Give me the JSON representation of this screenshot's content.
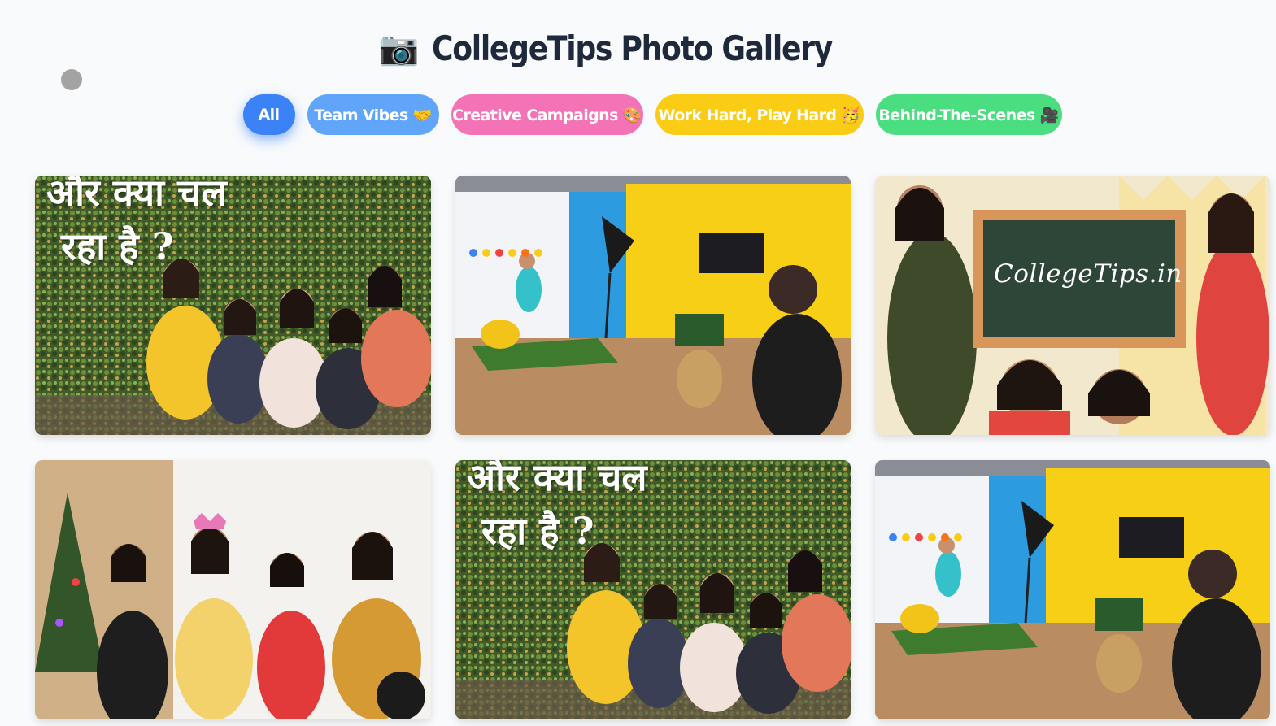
{
  "header": {
    "camera_icon": "📷",
    "title": "CollegeTips Photo Gallery"
  },
  "filters": [
    {
      "label": "All",
      "color": "#3b82f6",
      "active": true
    },
    {
      "label": "Team Vibes 🤝",
      "color": "#60a5fa"
    },
    {
      "label": "Creative Campaigns 🎨",
      "color": "#f472b6"
    },
    {
      "label": "Work Hard, Play Hard 🥳",
      "color": "#facc15"
    },
    {
      "label": "Behind-The-Scenes 🎥",
      "color": "#4ade80"
    }
  ],
  "gallery": {
    "cards": [
      {
        "kind": "team-wall",
        "overlay_line1": "और क्या चल",
        "overlay_line2": "रहा है ?"
      },
      {
        "kind": "studio-shoot"
      },
      {
        "kind": "collegetips-board",
        "board_text": "CollegeTips.in"
      },
      {
        "kind": "party-props"
      },
      {
        "kind": "team-wall",
        "overlay_line1": "और क्या चल",
        "overlay_line2": "रहा है ?"
      },
      {
        "kind": "studio-shoot"
      }
    ]
  }
}
